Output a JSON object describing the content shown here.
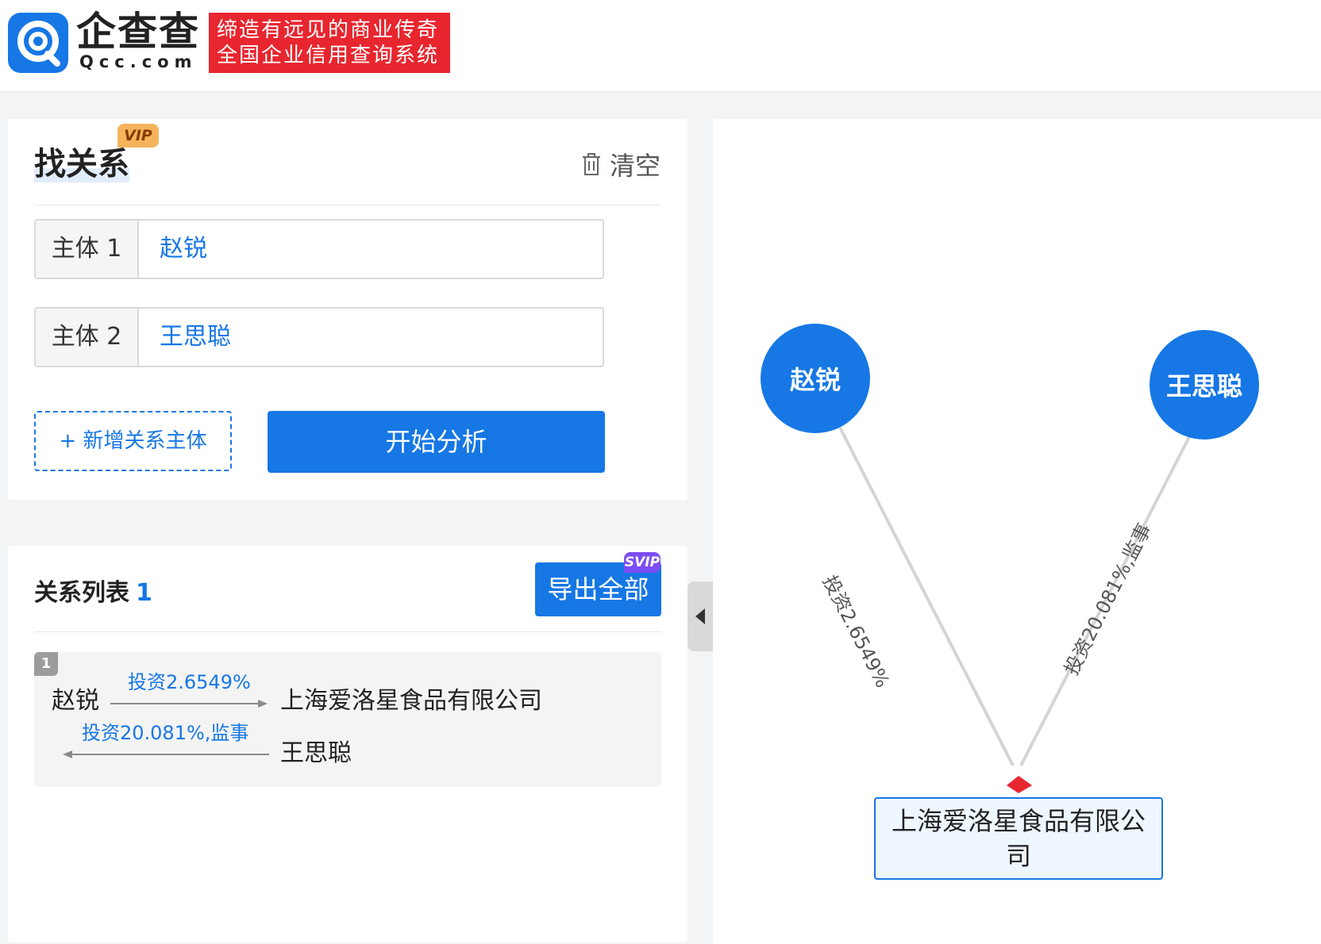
{
  "header": {
    "brand": "企查查",
    "domain": "Qcc.com",
    "slogan_line1": "缔造有远见的商业传奇",
    "slogan_line2": "全国企业信用查询系统"
  },
  "search_panel": {
    "title": "找关系",
    "vip_badge": "VIP",
    "clear_label": "清空",
    "subject1_label": "主体 1",
    "subject1_value": "赵锐",
    "subject2_label": "主体 2",
    "subject2_value": "王思聪",
    "add_label": "+ 新增关系主体",
    "start_label": "开始分析"
  },
  "list_panel": {
    "title": "关系列表",
    "count": "1",
    "export_label": "导出全部",
    "svip_badge": "SVIP",
    "rows": [
      {
        "index": "1",
        "from": "赵锐",
        "edge1": "投资2.6549%",
        "company": "上海爱洛星食品有限公司",
        "edge2": "投资20.081%,监事",
        "to": "王思聪"
      }
    ]
  },
  "graph": {
    "node_a": "赵锐",
    "node_b": "王思聪",
    "company": "上海爱洛星食品有限公司",
    "edge_a_label": "投资2.6549%",
    "edge_b_label": "投资20.081%,监事"
  },
  "colors": {
    "primary": "#1677e5",
    "slogan_bg": "#e8262f",
    "vip": "#f5b45c",
    "svip": "#7b4df2"
  },
  "icons": [
    "qcc-logo-icon",
    "trash-icon",
    "plus-icon",
    "arrow-right-icon",
    "arrow-left-icon",
    "collapse-left-icon"
  ]
}
